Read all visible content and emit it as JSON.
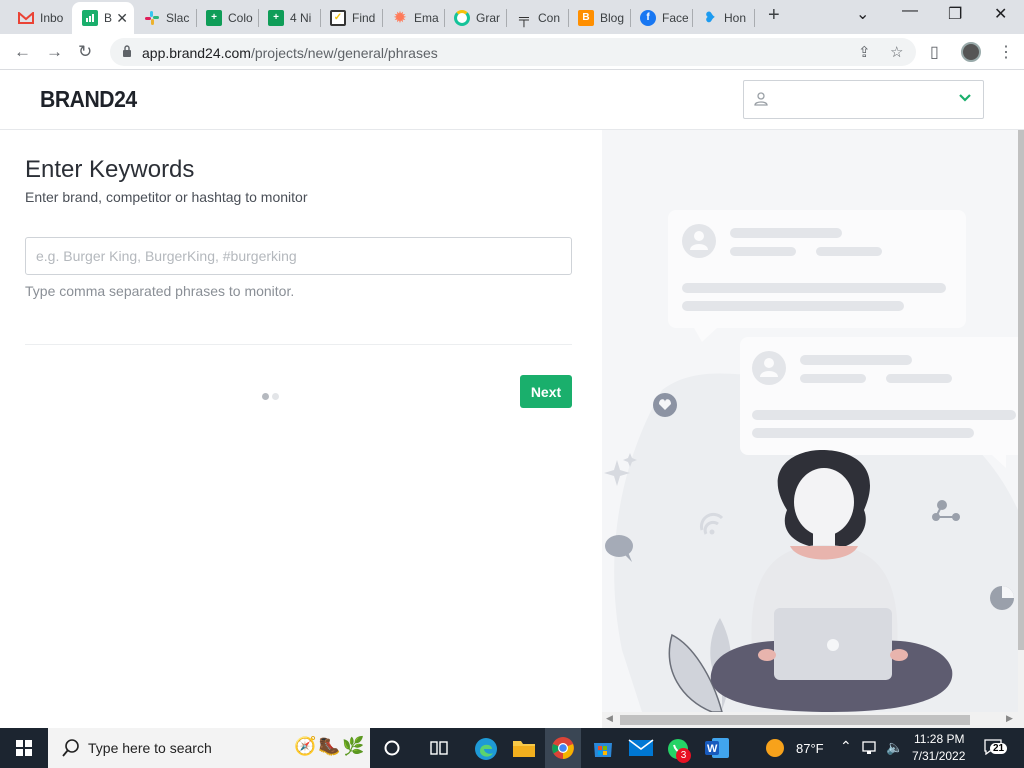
{
  "browser": {
    "tabs": [
      {
        "label": "Inbo",
        "icon": "gmail-icon",
        "color": "#ea4335"
      },
      {
        "label": "B",
        "icon": "brand24-icon",
        "color": "#1aaf6c",
        "active": true
      },
      {
        "label": "Slac",
        "icon": "slack-icon",
        "color": "#611f69"
      },
      {
        "label": "Colo",
        "icon": "sheets-icon",
        "color": "#0f9d58"
      },
      {
        "label": "4 Ni",
        "icon": "sheets-icon",
        "color": "#0f9d58"
      },
      {
        "label": "Find",
        "icon": "checkbox-icon",
        "color": "#f4c20d"
      },
      {
        "label": "Ema",
        "icon": "hubspot-icon",
        "color": "#ff7a59"
      },
      {
        "label": "Grar",
        "icon": "grammarly-icon",
        "color": "#15c39a"
      },
      {
        "label": "Con",
        "icon": "compose-icon",
        "color": "#333333"
      },
      {
        "label": "Blog",
        "icon": "blogger-icon",
        "color": "#ff8f00"
      },
      {
        "label": "Face",
        "icon": "facebook-icon",
        "color": "#1877f2"
      },
      {
        "label": "Hon",
        "icon": "twitter-icon",
        "color": "#1d9bf0"
      }
    ],
    "url_host": "app.brand24.com",
    "url_path": "/projects/new/general/phrases"
  },
  "header": {
    "logo": "BRAND24",
    "user_select_value": ""
  },
  "form": {
    "title": "Enter Keywords",
    "subtitle": "Enter brand, competitor or hashtag to monitor",
    "input_placeholder": "e.g. Burger King, BurgerKing, #burgerking",
    "input_value": "",
    "hint": "Type comma separated phrases to monitor.",
    "next_label": "Next",
    "steps_total": 2,
    "step_current": 1
  },
  "colors": {
    "accent": "#1aaf6c",
    "text_dark": "#2b2f36",
    "illustration_bg": "#f5f6f8"
  },
  "taskbar": {
    "search_placeholder": "Type here to search",
    "weather": "87°F",
    "time": "11:28 PM",
    "date": "7/31/2022",
    "notifications": "21",
    "whatsapp_badge": "3"
  }
}
